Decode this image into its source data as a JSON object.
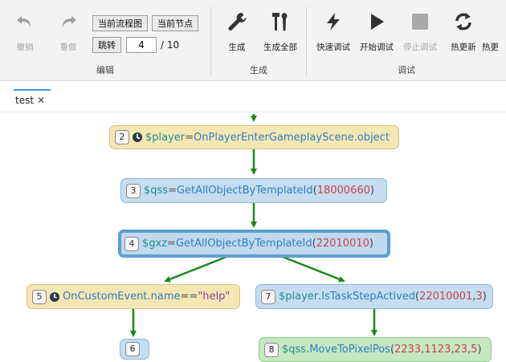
{
  "toolbar": {
    "edit": {
      "label": "编辑",
      "undo": "撤销",
      "redo": "重做",
      "current_flowchart": "当前流程图",
      "current_node": "当前节点",
      "jump": "跳转",
      "page_value": "4",
      "page_total": "/ 10"
    },
    "generate": {
      "label": "生成",
      "generate": "生成",
      "generate_all": "生成全部"
    },
    "debug": {
      "label": "调试",
      "quick_debug": "快速调试",
      "start_debug": "开始调试",
      "stop_debug": "停止调试",
      "hot_update": "热更新",
      "hot_update_2": "热更"
    }
  },
  "tabs": [
    {
      "title": "test",
      "close": "✕"
    }
  ],
  "flow": {
    "nodes": [
      {
        "id": "2",
        "kind": "event",
        "has_clock": true,
        "tokens": [
          [
            "var",
            "$player"
          ],
          [
            "op",
            "="
          ],
          [
            "func",
            "OnPlayerEnterGameplayScene.object"
          ]
        ]
      },
      {
        "id": "3",
        "kind": "call",
        "has_clock": false,
        "tokens": [
          [
            "var",
            "$qss"
          ],
          [
            "op",
            "="
          ],
          [
            "func",
            "GetAllObjectByTemplateId"
          ],
          [
            "par",
            "("
          ],
          [
            "num",
            "18000660"
          ],
          [
            "par",
            ")"
          ]
        ]
      },
      {
        "id": "4",
        "kind": "call",
        "selected": true,
        "has_clock": false,
        "tokens": [
          [
            "var",
            "$gxz"
          ],
          [
            "op",
            "="
          ],
          [
            "func",
            "GetAllObjectByTemplateId"
          ],
          [
            "par",
            "("
          ],
          [
            "num",
            "22010010"
          ],
          [
            "par",
            ")"
          ]
        ]
      },
      {
        "id": "5",
        "kind": "event",
        "has_clock": true,
        "tokens": [
          [
            "func",
            "OnCustomEvent.name"
          ],
          [
            "op",
            "=="
          ],
          [
            "str",
            "\"help\""
          ]
        ]
      },
      {
        "id": "7",
        "kind": "call",
        "has_clock": false,
        "tokens": [
          [
            "var",
            "$player"
          ],
          [
            "op",
            "."
          ],
          [
            "func",
            "IsTaskStepActived"
          ],
          [
            "par",
            "("
          ],
          [
            "num",
            "22010001"
          ],
          [
            "op",
            ","
          ],
          [
            "num",
            "3"
          ],
          [
            "par",
            ")"
          ]
        ]
      },
      {
        "id": "6",
        "kind": "call",
        "has_clock": false,
        "tokens": []
      },
      {
        "id": "8",
        "kind": "action",
        "has_clock": false,
        "tokens": [
          [
            "var",
            "$qss"
          ],
          [
            "op",
            "."
          ],
          [
            "func",
            "MoveToPixelPos"
          ],
          [
            "par",
            "("
          ],
          [
            "num",
            "2233"
          ],
          [
            "op",
            ","
          ],
          [
            "num",
            "1123"
          ],
          [
            "op",
            ","
          ],
          [
            "num",
            "23"
          ],
          [
            "op",
            ","
          ],
          [
            "num",
            "5"
          ],
          [
            "par",
            ")"
          ]
        ]
      }
    ],
    "edge_color": "#1a8a1a"
  },
  "colors": {
    "accent": "#3a96dd",
    "event_node": "#f4e7b3",
    "call_node": "#c6ddf0",
    "action_node": "#c7e7c3",
    "edge": "#1a8a1a"
  }
}
